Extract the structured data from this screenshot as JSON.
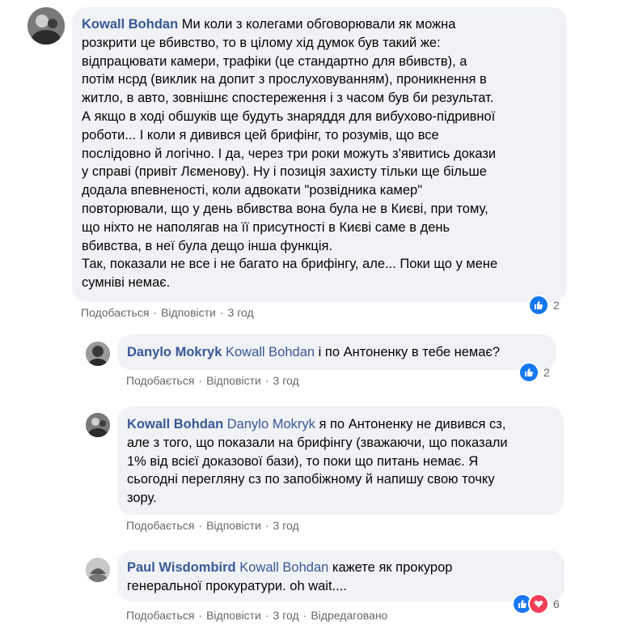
{
  "comments": [
    {
      "author": "Kowall Bohdan",
      "mention": "",
      "lines": [
        "Ми коли з колегами обговорювали як можна",
        "розкрити це вбивство, то в цілому хід думок був такий же:",
        "відпрацювати камери, трафіки (це стандартно для вбивств), а",
        "потім нсрд (виклик на допит з прослуховуванням), проникнення в",
        "житло, в авто, зовнішнє спостереження і з часом був би результат.",
        "А якщо в ході обшуків ще будуть знаряддя для вибухово-підривної",
        "роботи... І коли я дивився цей брифінг, то розумів, що все",
        "послідовно й логічно. І да, через три роки можуть з'явитись докази",
        "у справі (привіт Лєменову). Ну і позиція захисту тільки ще більше",
        "додала впевненості, коли адвокати \"розвідника камер\"",
        "повторювали, що у день вбивства вона була не в Києві, при тому,",
        "що ніхто не наполягав на її присутності в Києві саме в день",
        "вбивства, в неї була дещо інша функція.",
        "Так, показали не все і не багато на брифінгу, але... Поки що у мене",
        "сумніві немає."
      ],
      "like_label": "Подобається",
      "reply_label": "Відповісти",
      "time": "3 год",
      "edited": "",
      "reaction_count": "2",
      "reactions": [
        "like-icon"
      ]
    },
    {
      "author": "Danylo Mokryk",
      "mention": "Kowall Bohdan",
      "lines": [
        " і по Антоненку в тебе немає?"
      ],
      "like_label": "Подобається",
      "reply_label": "Відповісти",
      "time": "3 год",
      "edited": "",
      "reaction_count": "2",
      "reactions": [
        "like-icon"
      ]
    },
    {
      "author": "Kowall Bohdan",
      "mention": "Danylo Mokryk",
      "lines": [
        " я по Антоненку не дивився сз,",
        "але з того, що показали на брифінгу (зважаючи, що показали",
        "1% від всієї доказової бази), то поки що питань немає. Я",
        "сьогодні перегляну сз по запобіжному й напишу свою точку",
        "зору."
      ],
      "like_label": "Подобається",
      "reply_label": "Відповісти",
      "time": "3 год",
      "edited": "",
      "reaction_count": "",
      "reactions": []
    },
    {
      "author": "Paul Wisdombird",
      "mention": "Kowall Bohdan",
      "lines": [
        " кажете як прокурор",
        "генеральної прокуратури. oh wait...."
      ],
      "like_label": "Подобається",
      "reply_label": "Відповісти",
      "time": "3 год",
      "edited": "Відредаговано",
      "reaction_count": "6",
      "reactions": [
        "like-icon",
        "love-icon"
      ]
    }
  ],
  "colors": {
    "bubble": "#f0f2f5",
    "author": "#385898",
    "meta": "#65676b",
    "like": "#1877f2",
    "love": "#f33e58"
  }
}
